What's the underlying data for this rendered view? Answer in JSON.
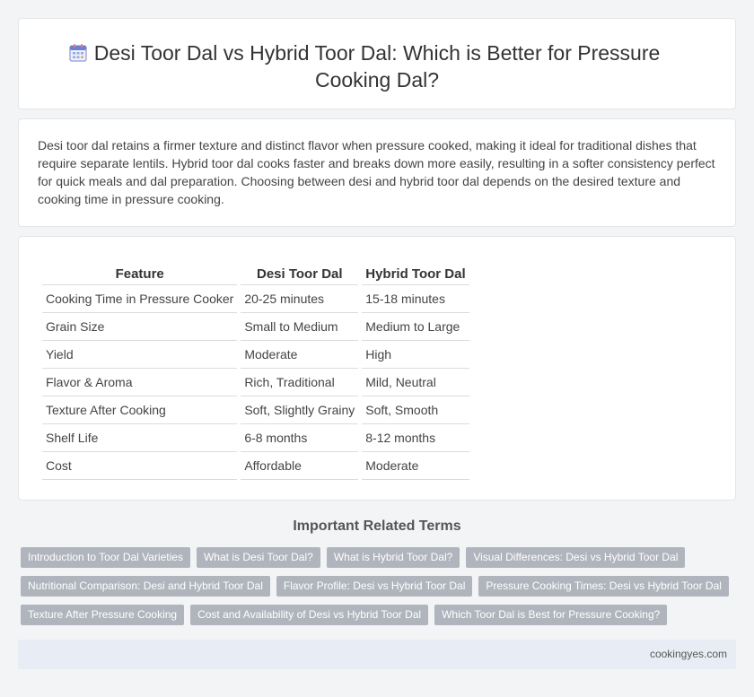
{
  "header": {
    "icon": "calendar-icon",
    "title": "Desi Toor Dal vs Hybrid Toor Dal: Which is Better for Pressure Cooking Dal?"
  },
  "summary": "Desi toor dal retains a firmer texture and distinct flavor when pressure cooked, making it ideal for traditional dishes that require separate lentils. Hybrid toor dal cooks faster and breaks down more easily, resulting in a softer consistency perfect for quick meals and dal preparation. Choosing between desi and hybrid toor dal depends on the desired texture and cooking time in pressure cooking.",
  "table": {
    "headers": [
      "Feature",
      "Desi Toor Dal",
      "Hybrid Toor Dal"
    ],
    "rows": [
      [
        "Cooking Time in Pressure Cooker",
        "20-25 minutes",
        "15-18 minutes"
      ],
      [
        "Grain Size",
        "Small to Medium",
        "Medium to Large"
      ],
      [
        "Yield",
        "Moderate",
        "High"
      ],
      [
        "Flavor & Aroma",
        "Rich, Traditional",
        "Mild, Neutral"
      ],
      [
        "Texture After Cooking",
        "Soft, Slightly Grainy",
        "Soft, Smooth"
      ],
      [
        "Shelf Life",
        "6-8 months",
        "8-12 months"
      ],
      [
        "Cost",
        "Affordable",
        "Moderate"
      ]
    ]
  },
  "related": {
    "heading": "Important Related Terms",
    "rows": [
      [
        "Introduction to Toor Dal Varieties",
        "What is Desi Toor Dal?",
        "What is Hybrid Toor Dal?",
        "Visual Differences: Desi vs Hybrid Toor Dal"
      ],
      [
        "Nutritional Comparison: Desi and Hybrid Toor Dal",
        "Flavor Profile: Desi vs Hybrid Toor Dal",
        "Pressure Cooking Times: Desi vs Hybrid Toor Dal"
      ],
      [
        "Texture After Pressure Cooking",
        "Cost and Availability of Desi vs Hybrid Toor Dal",
        "Which Toor Dal is Best for Pressure Cooking?"
      ]
    ]
  },
  "footer": {
    "site": "cookingyes.com"
  },
  "colors": {
    "tag_bg": "#b0b5bd",
    "footer_bg": "#e8edf5",
    "page_bg": "#f3f4f6"
  }
}
